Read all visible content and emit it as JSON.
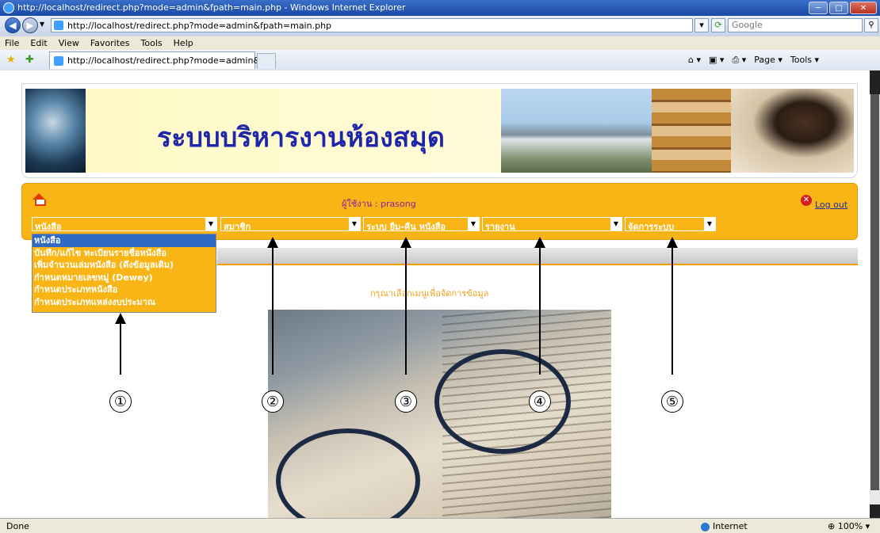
{
  "window": {
    "title": "http://localhost/redirect.php?mode=admin&fpath=main.php - Windows Internet Explorer"
  },
  "address": {
    "url": "http://localhost/redirect.php?mode=admin&fpath=main.php",
    "search_placeholder": "Google"
  },
  "menubar": {
    "items": [
      "File",
      "Edit",
      "View",
      "Favorites",
      "Tools",
      "Help"
    ]
  },
  "tab": {
    "label": "http://localhost/redirect.php?mode=admin&fp..."
  },
  "commandbar": {
    "page": "Page ▾",
    "tools": "Tools ▾"
  },
  "site": {
    "title": "ระบบบริหารงานห้องสมุด",
    "user": "ผู้ใช้งาน : prasong",
    "logout": "Log out",
    "prompt": "กรุณาเลือกเมนูเพื่อจัดการข้อมูล"
  },
  "menus": [
    {
      "selected": "หนังสือ"
    },
    {
      "selected": "สมาชิก"
    },
    {
      "selected": "ระบบ ยืม-คืน หนังสือ"
    },
    {
      "selected": "รายงาน"
    },
    {
      "selected": "จัดการระบบ"
    }
  ],
  "dropdown": {
    "options": [
      "หนังสือ",
      "บันทึก/แก้ไข ทะเบียนรายชื่อหนังสือ",
      "เพิ่มจำนวนเล่มหนังสือ (ดึงข้อมูลเดิม)",
      "กำหนดหมายเลขหมู่ (Dewey)",
      "กำหนดประเภทหนังสือ",
      "กำหนดประเภทแหล่งงบประมาณ"
    ]
  },
  "annotations": [
    "①",
    "②",
    "③",
    "④",
    "⑤"
  ],
  "status": {
    "text": "Done",
    "zone": "Internet",
    "zoom": "100%"
  },
  "colors": {
    "menu_panel": "#f9b516",
    "selected_option": "#316ac5",
    "title_text": "#1f27a8"
  }
}
